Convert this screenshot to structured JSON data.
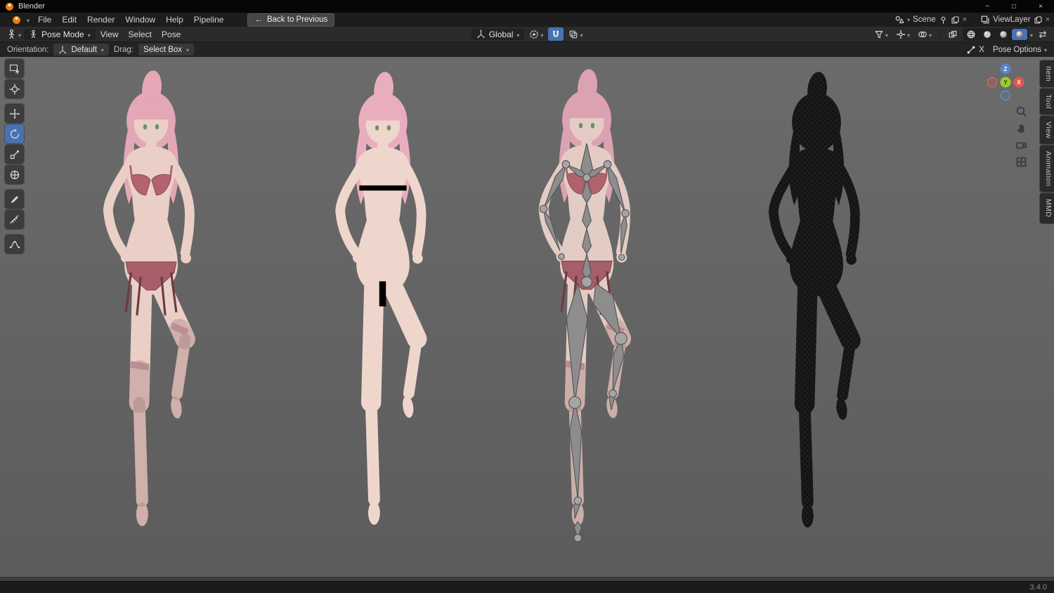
{
  "titlebar": {
    "app_name": "Blender",
    "minimize_icon": "−",
    "maximize_icon": "□",
    "close_icon": "×"
  },
  "menubar": {
    "items": [
      "File",
      "Edit",
      "Render",
      "Window",
      "Help",
      "Pipeline"
    ],
    "back_button": {
      "icon": "←",
      "label": "Back to Previous"
    },
    "scene": {
      "label": "Scene"
    },
    "view_layer": {
      "label": "ViewLayer"
    }
  },
  "viewport_header": {
    "mode": "Pose Mode",
    "menus": [
      "View",
      "Select",
      "Pose"
    ],
    "orientation": "Global"
  },
  "tool_settings": {
    "orientation_label": "Orientation:",
    "orientation_value": "Default",
    "drag_label": "Drag:",
    "drag_value": "Select Box",
    "mirror_x_label": "X",
    "pose_options_label": "Pose Options"
  },
  "left_toolbar": {
    "tools": [
      {
        "id": "tweak-select",
        "active": false
      },
      {
        "id": "cursor-3d",
        "active": false
      },
      {
        "id": "move",
        "active": false
      },
      {
        "id": "rotate",
        "active": true
      },
      {
        "id": "scale",
        "active": false
      },
      {
        "id": "transform",
        "active": false
      },
      {
        "id": "annotate",
        "active": false
      },
      {
        "id": "measure",
        "active": false
      },
      {
        "id": "pose-breakdowner",
        "active": false
      }
    ]
  },
  "nav_gizmo": {
    "axis_x": "X",
    "axis_y": "Y",
    "axis_z": "Z"
  },
  "sidebar_tabs": [
    "Item",
    "Tool",
    "View",
    "Animation",
    "MMD"
  ],
  "viewport": {
    "figures": [
      {
        "id": "model-textured-underwear"
      },
      {
        "id": "model-solid-censored"
      },
      {
        "id": "model-armature-bones"
      },
      {
        "id": "model-wireframe-dark"
      }
    ]
  },
  "statusbar": {
    "version": "3.4.0"
  },
  "colors": {
    "accent": "#4772b3",
    "axis_x": "#e2564e",
    "axis_y": "#9acd32",
    "axis_z": "#5087c9",
    "viewport_bg": "#646464"
  }
}
